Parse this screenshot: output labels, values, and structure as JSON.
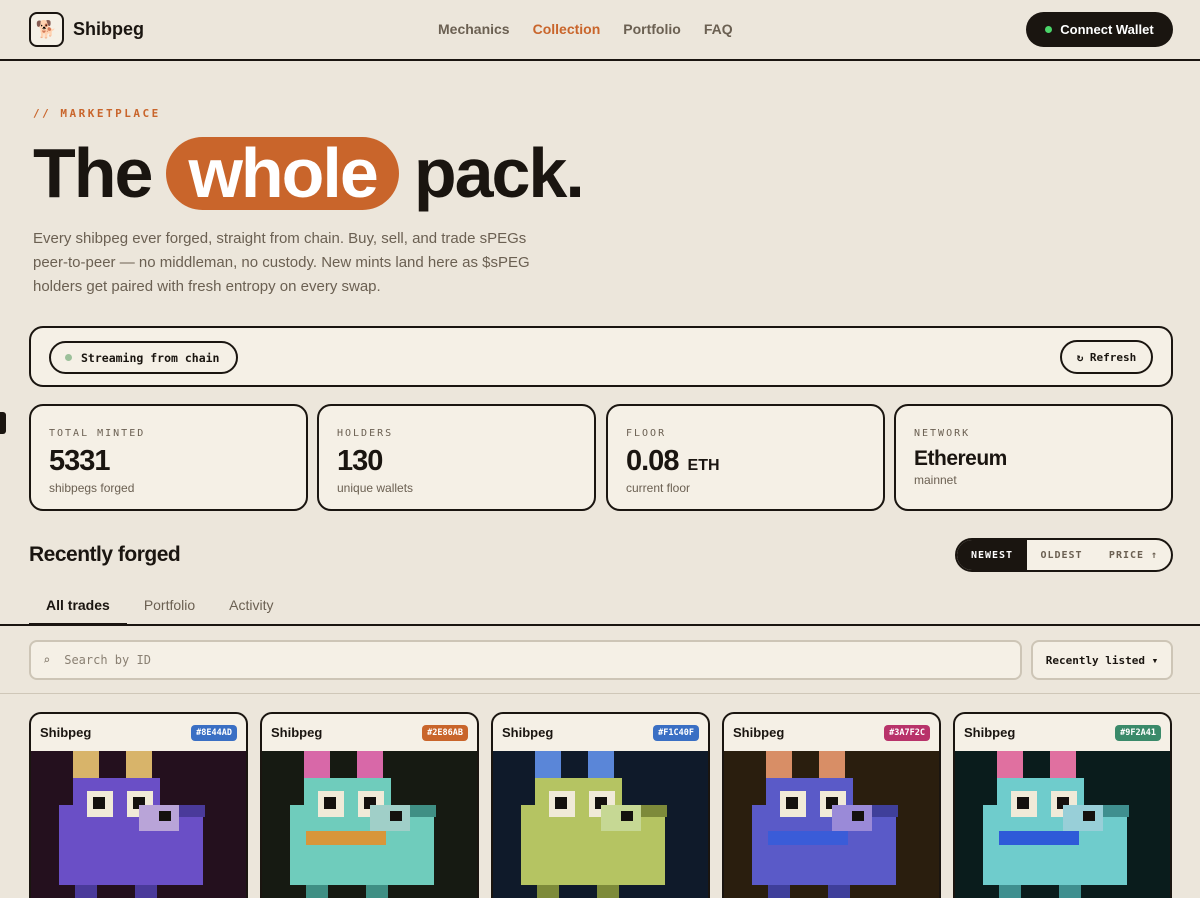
{
  "nav": {
    "logo_icon": "🐕",
    "brand": "Shibpeg",
    "links": [
      "Mechanics",
      "Collection",
      "Portfolio",
      "FAQ"
    ],
    "active_link": "Collection",
    "connect_label": "Connect Wallet"
  },
  "hero": {
    "eyebrow": "// MARKETPLACE",
    "headline_before": "The",
    "headline_highlight": "whole",
    "headline_after": "pack.",
    "description": "Every shibpeg ever forged, straight from chain. Buy, sell, and trade sPEGs peer-to-peer — no middleman, no custody. New mints land here as $sPEG holders get paired with fresh entropy on every swap."
  },
  "status": {
    "stream_label": "Streaming from chain",
    "refresh_label": "↻ Refresh"
  },
  "stats": [
    {
      "label": "TOTAL MINTED",
      "value": "5331",
      "unit": "",
      "sub": "shibpegs forged"
    },
    {
      "label": "HOLDERS",
      "value": "130",
      "unit": "",
      "sub": "unique wallets"
    },
    {
      "label": "FLOOR",
      "value": "0.08",
      "unit": "ETH",
      "sub": "current floor"
    },
    {
      "label": "NETWORK",
      "value": "Ethereum",
      "unit": "",
      "sub": "mainnet"
    }
  ],
  "recent": {
    "title": "Recently forged",
    "sort_options": [
      "NEWEST",
      "OLDEST",
      "PRICE ↑"
    ],
    "active_sort": "NEWEST",
    "tabs": [
      "All trades",
      "Portfolio",
      "Activity"
    ],
    "active_tab": "All trades",
    "search_placeholder": "Search by ID",
    "sort_select": "Recently listed ▾"
  },
  "cards": [
    {
      "name": "Shibpeg",
      "tag": "#8E44AD",
      "tag_color": "#3a6fc4",
      "bg": "#24101e",
      "body": "#6a4fc6",
      "ear": "#d8b46a",
      "mouth": "#6a4fc6",
      "leg": "#4a3a9a",
      "patch": "#b9a4d8",
      "tail": "#4a3a9a"
    },
    {
      "name": "Shibpeg",
      "tag": "#2E86AB",
      "tag_color": "#c9652b",
      "bg": "#161a12",
      "body": "#6fccbc",
      "ear": "#d868a8",
      "mouth": "#d8963a",
      "leg": "#3f8f84",
      "patch": "#a0cfc8",
      "tail": "#3f8f84"
    },
    {
      "name": "Shibpeg",
      "tag": "#F1C40F",
      "tag_color": "#3a6fc4",
      "bg": "#0f1a2a",
      "body": "#b5c462",
      "ear": "#5a86d8",
      "mouth": "#b5c462",
      "leg": "#7d8a3a",
      "patch": "#c6d894",
      "tail": "#7d8a3a"
    },
    {
      "name": "Shibpeg",
      "tag": "#3A7F2C",
      "tag_color": "#b8336a",
      "bg": "#2a1e0e",
      "body": "#5a5ac8",
      "ear": "#d88e66",
      "mouth": "#3a5cd8",
      "leg": "#3f3f9a",
      "patch": "#9a8ad8",
      "tail": "#3f3f9a"
    },
    {
      "name": "Shibpeg",
      "tag": "#9F2A41",
      "tag_color": "#3a8a6a",
      "bg": "#0a1c1c",
      "body": "#6fcccc",
      "ear": "#e070a0",
      "mouth": "#2e5ad8",
      "leg": "#3f8f8f",
      "patch": "#98cfd8",
      "tail": "#3f8f8f"
    }
  ]
}
